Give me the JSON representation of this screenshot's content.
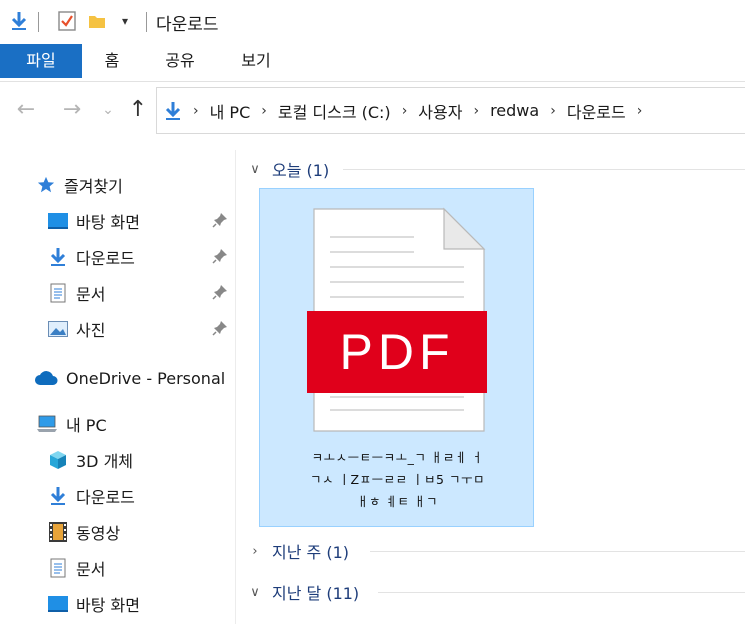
{
  "titlebar": {
    "title": "다운로드",
    "icons": [
      "download-arrow-icon",
      "properties-check-icon",
      "folder-icon",
      "customize-dropdown-icon"
    ]
  },
  "ribbon": {
    "tabs": [
      "파일",
      "홈",
      "공유",
      "보기"
    ]
  },
  "address": {
    "back": "←",
    "forward": "→",
    "recent": "⌄",
    "up": "↑",
    "crumbs": [
      "내 PC",
      "로컬 디스크 (C:)",
      "사용자",
      "redwa",
      "다운로드"
    ]
  },
  "sidebar": {
    "quick_access": "즐겨찾기",
    "quick_items": [
      "바탕 화면",
      "다운로드",
      "문서",
      "사진"
    ],
    "onedrive": "OneDrive - Personal",
    "this_pc": "내 PC",
    "pc_items": [
      "3D 개체",
      "다운로드",
      "동영상",
      "문서",
      "바탕 화면"
    ]
  },
  "content": {
    "groups": {
      "today": "오늘 (1)",
      "last_week": "지난 주 (1)",
      "last_month": "지난 달 (11)"
    },
    "file": {
      "badge": "PDF",
      "name_lines": [
        "ㅋㅗㅅㅡㅌㅡㅋㅗ_ㄱ ㅐㄹㅔ ㅓ",
        "ㄱㅅ ㅣZㅍㅡㄹㄹ ㅣㅂ5 ㄱㅜㅁ",
        "ㅐㅎ ㅖㅌ ㅐㄱ"
      ]
    }
  },
  "colors": {
    "accent": "#1a6fc4",
    "selection": "#cce8ff",
    "pdf_red": "#e0001b"
  }
}
